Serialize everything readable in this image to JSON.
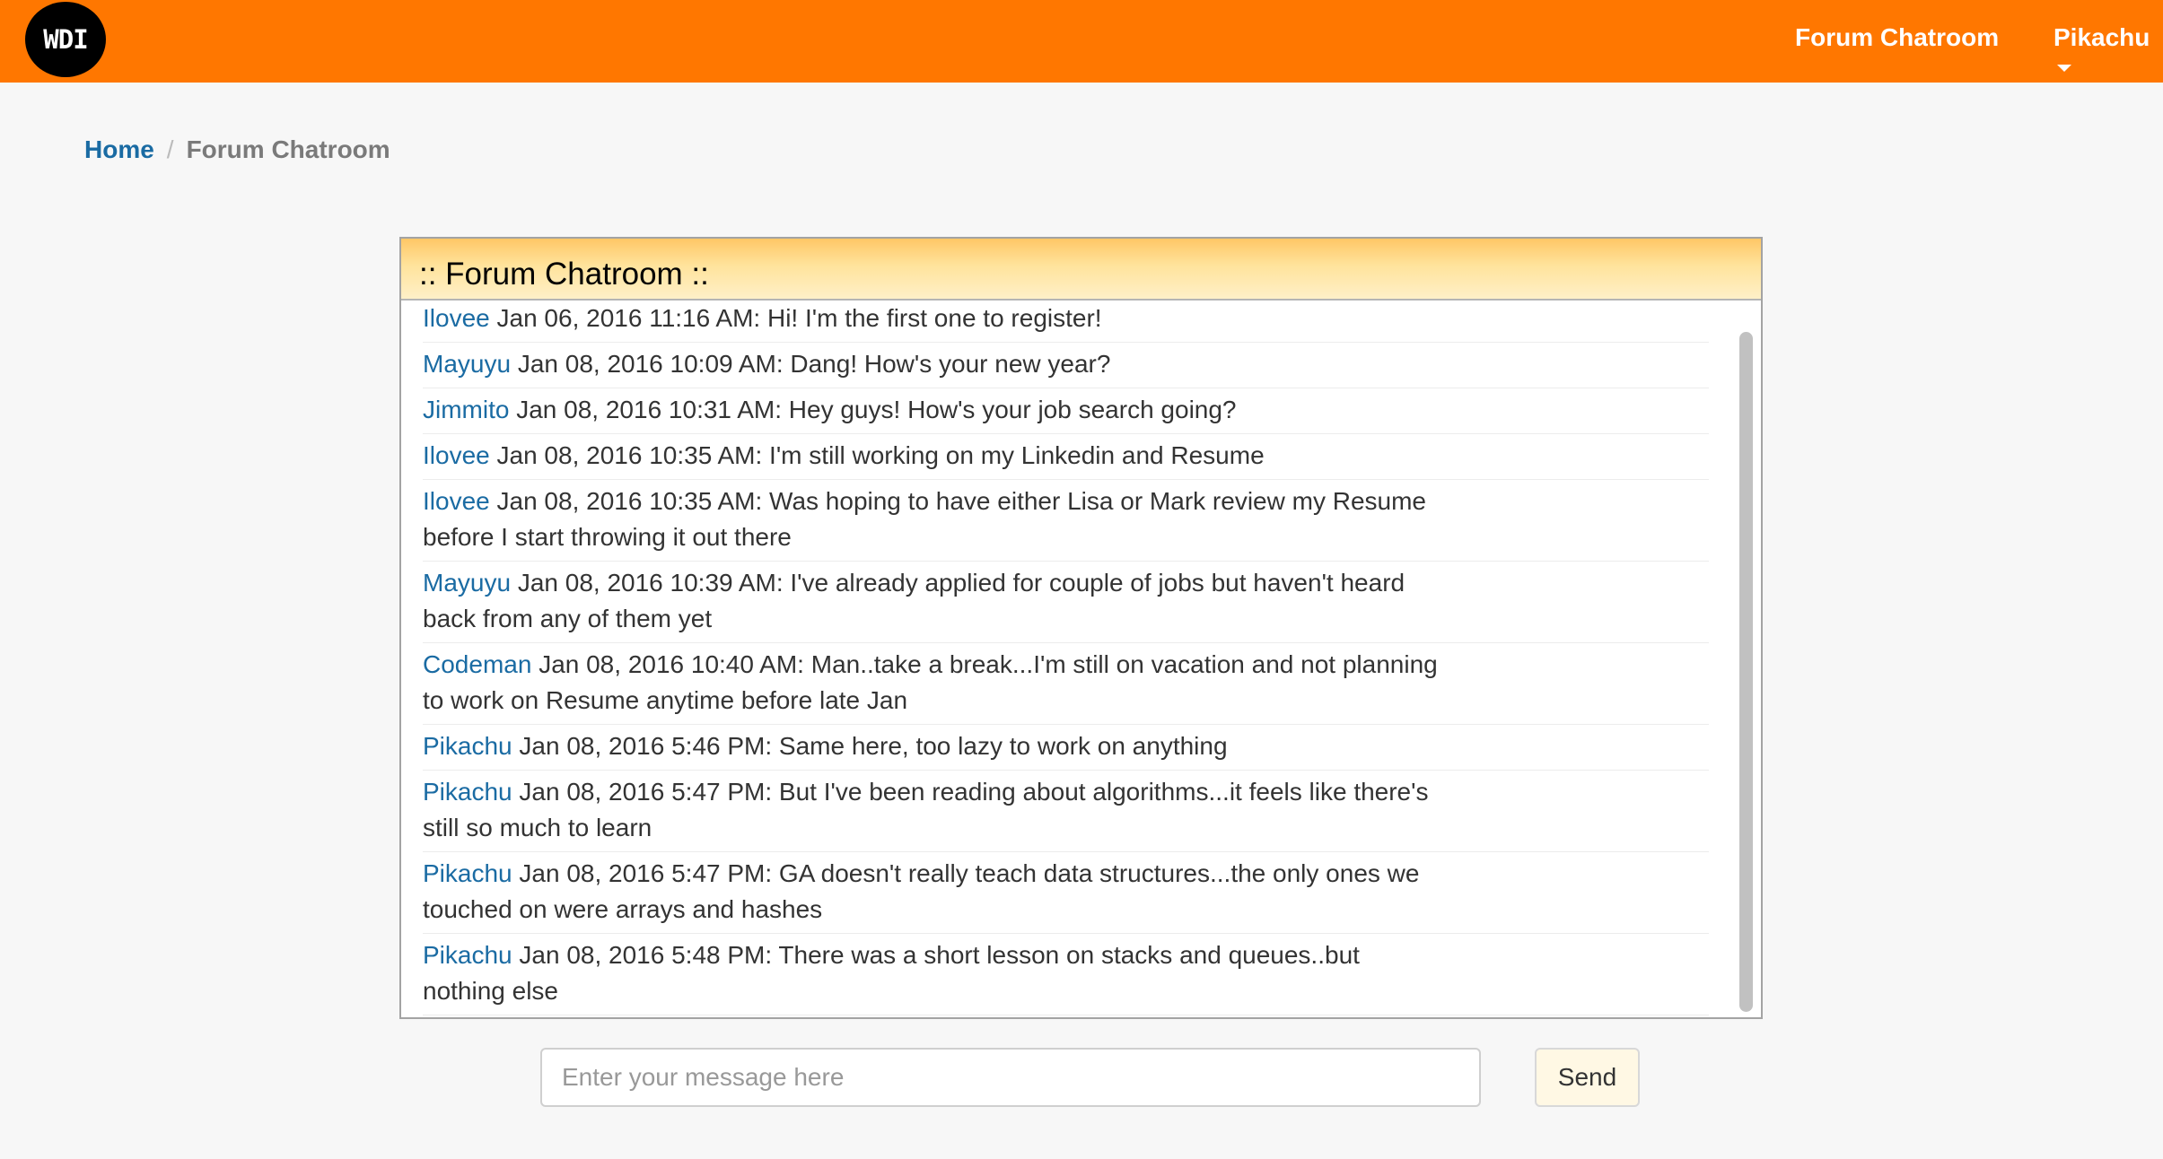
{
  "navbar": {
    "logo_text": "WDI",
    "forum_link": "Forum Chatroom",
    "user_menu": "Pikachu"
  },
  "breadcrumb": {
    "home": "Home",
    "separator": "/",
    "current": "Forum Chatroom"
  },
  "chat": {
    "title": ":: Forum Chatroom ::",
    "messages": [
      {
        "user": "Ilovee",
        "text": "Jan 06, 2016 11:16 AM: Hi! I'm the first one to register!"
      },
      {
        "user": "Mayuyu",
        "text": "Jan 08, 2016 10:09 AM: Dang! How's your new year?"
      },
      {
        "user": "Jimmito",
        "text": "Jan 08, 2016 10:31 AM: Hey guys! How's your job search going?"
      },
      {
        "user": "Ilovee",
        "text": "Jan 08, 2016 10:35 AM: I'm still working on my Linkedin and Resume"
      },
      {
        "user": "Ilovee",
        "text": "Jan 08, 2016 10:35 AM: Was hoping to have either Lisa or Mark review my Resume before I start throwing it out there"
      },
      {
        "user": "Mayuyu",
        "text": "Jan 08, 2016 10:39 AM: I've already applied for couple of jobs but haven't heard back from any of them yet"
      },
      {
        "user": "Codeman",
        "text": "Jan 08, 2016 10:40 AM: Man..take a break...I'm still on vacation and not planning to work on Resume anytime before late Jan"
      },
      {
        "user": "Pikachu",
        "text": "Jan 08, 2016 5:46 PM: Same here, too lazy to work on anything"
      },
      {
        "user": "Pikachu",
        "text": "Jan 08, 2016 5:47 PM: But I've been reading about algorithms...it feels like there's still so much to learn"
      },
      {
        "user": "Pikachu",
        "text": "Jan 08, 2016 5:47 PM: GA doesn't really teach data structures...the only ones we touched on were arrays and hashes"
      },
      {
        "user": "Pikachu",
        "text": "Jan 08, 2016 5:48 PM: There was a short lesson on stacks and queues..but nothing else"
      }
    ]
  },
  "composer": {
    "placeholder": "Enter your message here",
    "value": "",
    "send_label": "Send"
  }
}
